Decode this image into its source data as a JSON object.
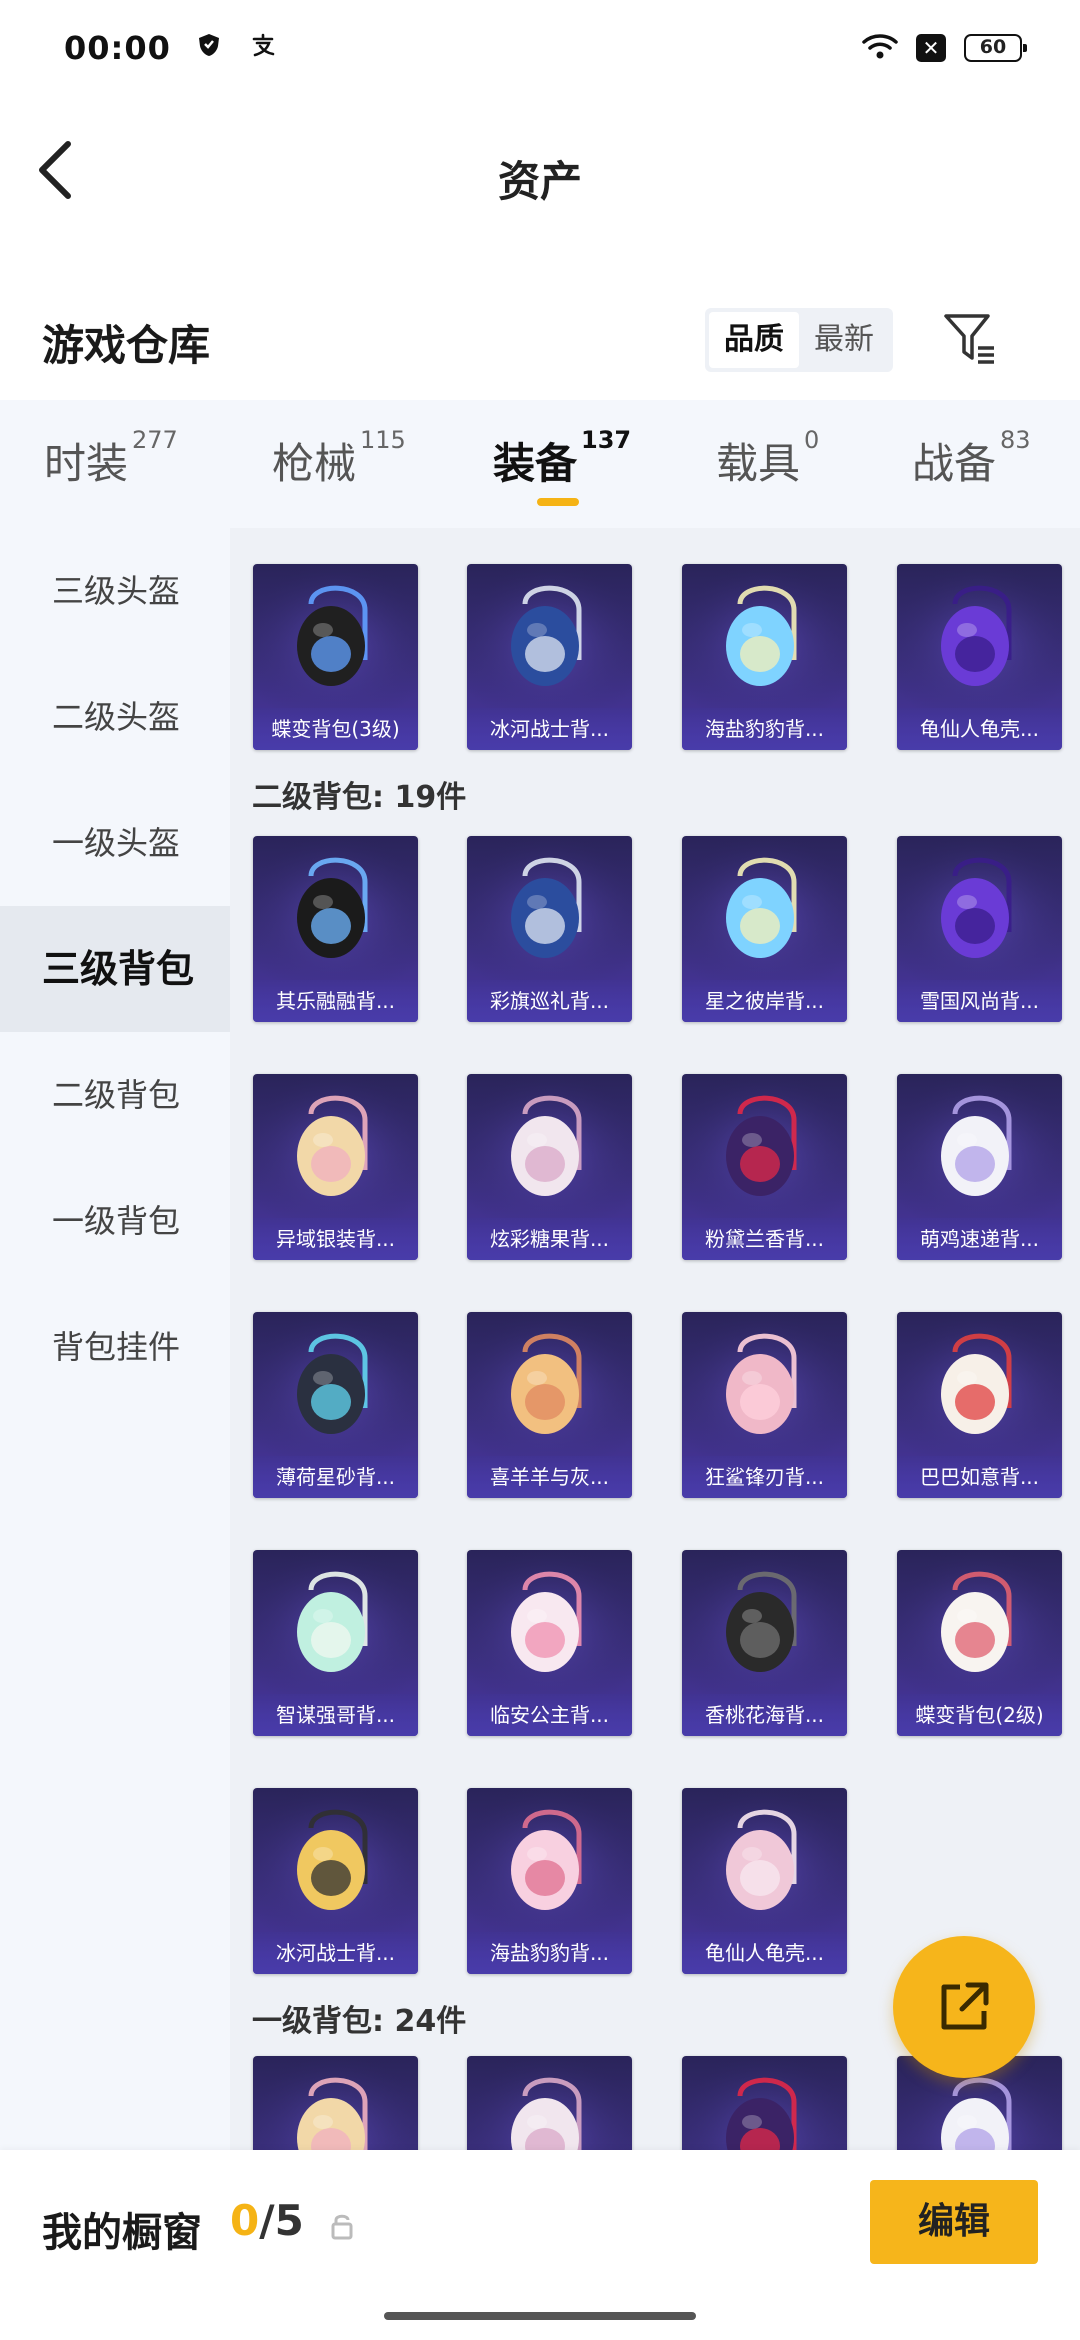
{
  "status": {
    "time": "00:00",
    "battery": "60"
  },
  "nav": {
    "title": "资产"
  },
  "section": {
    "title": "游戏仓库",
    "sort_quality": "品质",
    "sort_newest": "最新"
  },
  "tabs": [
    {
      "label": "时装",
      "count": "277"
    },
    {
      "label": "枪械",
      "count": "115"
    },
    {
      "label": "装备",
      "count": "137"
    },
    {
      "label": "载具",
      "count": "0"
    },
    {
      "label": "战备",
      "count": "83"
    }
  ],
  "sidebar": [
    "三级头盔",
    "二级头盔",
    "一级头盔",
    "三级背包",
    "二级背包",
    "一级背包",
    "背包挂件"
  ],
  "groups": {
    "level2": "二级背包: 19件",
    "level1": "一级背包: 24件"
  },
  "items_row0": [
    "蝶变背包(3级)",
    "冰河战士背...",
    "海盐豹豹背...",
    "龟仙人龟壳..."
  ],
  "items_level2": [
    "其乐融融背...",
    "彩旗巡礼背...",
    "星之彼岸背...",
    "雪国风尚背...",
    "异域银装背...",
    "炫彩糖果背...",
    "粉黛兰香背...",
    "萌鸡速递背...",
    "薄荷星砂背...",
    "喜羊羊与灰...",
    "狂鲨锋刃背...",
    "巴巴如意背...",
    "智谋强哥背...",
    "临安公主背...",
    "香桃花海背...",
    "蝶变背包(2级)",
    "冰河战士背...",
    "海盐豹豹背...",
    "龟仙人龟壳..."
  ],
  "bottom": {
    "label": "我的橱窗",
    "current": "0",
    "total": "/5",
    "edit": "编辑"
  },
  "colors": {
    "accent": "#f6b51b",
    "card": "#3b2f7e"
  }
}
